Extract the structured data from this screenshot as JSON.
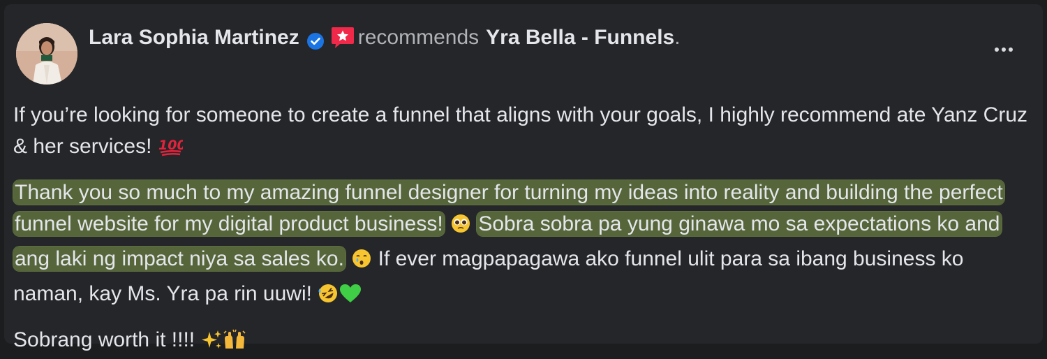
{
  "post": {
    "author": "Lara Sophia Martinez",
    "recommends_text": "recommends",
    "page_name": "Yra Bella - Funnels",
    "period": ".",
    "para1": "If you’re looking for someone to create a funnel that aligns with your goals, I highly recommend ate Yanz Cruz & her services!",
    "para2_highlight_1": "Thank you so much to my amazing funnel designer for turning my ideas into reality and building the perfect funnel website for my digital product business!",
    "para2_highlight_2": "Sobra sobra pa yung ginawa mo sa expectations ko and ang laki ng impact niya sa sales ko.",
    "para2_rest": "If ever magpapagawa ako funnel ulit para sa ibang business ko naman, kay Ms. Yra pa rin uuwi!",
    "para3": "Sobrang worth it !!!!"
  },
  "icons": {
    "verified": "verified-badge-icon",
    "recommend": "recommend-star-icon",
    "more": "more-options-icon",
    "emoji_100": "hundred-points-icon",
    "emoji_pleading": "pleading-face-icon",
    "emoji_holding_tears": "face-holding-back-tears-icon",
    "emoji_rofl": "rolling-on-floor-laughing-icon",
    "emoji_green_heart": "green-heart-icon",
    "emoji_sparkles": "sparkles-icon",
    "emoji_raising_hands": "raising-hands-icon"
  },
  "colors": {
    "card_bg": "#252629",
    "text": "#e4e6eb",
    "secondary_text": "#b0b3b8",
    "highlight": "#56663a",
    "verified_blue": "#1b74e4",
    "recommend_red": "#f02849"
  }
}
